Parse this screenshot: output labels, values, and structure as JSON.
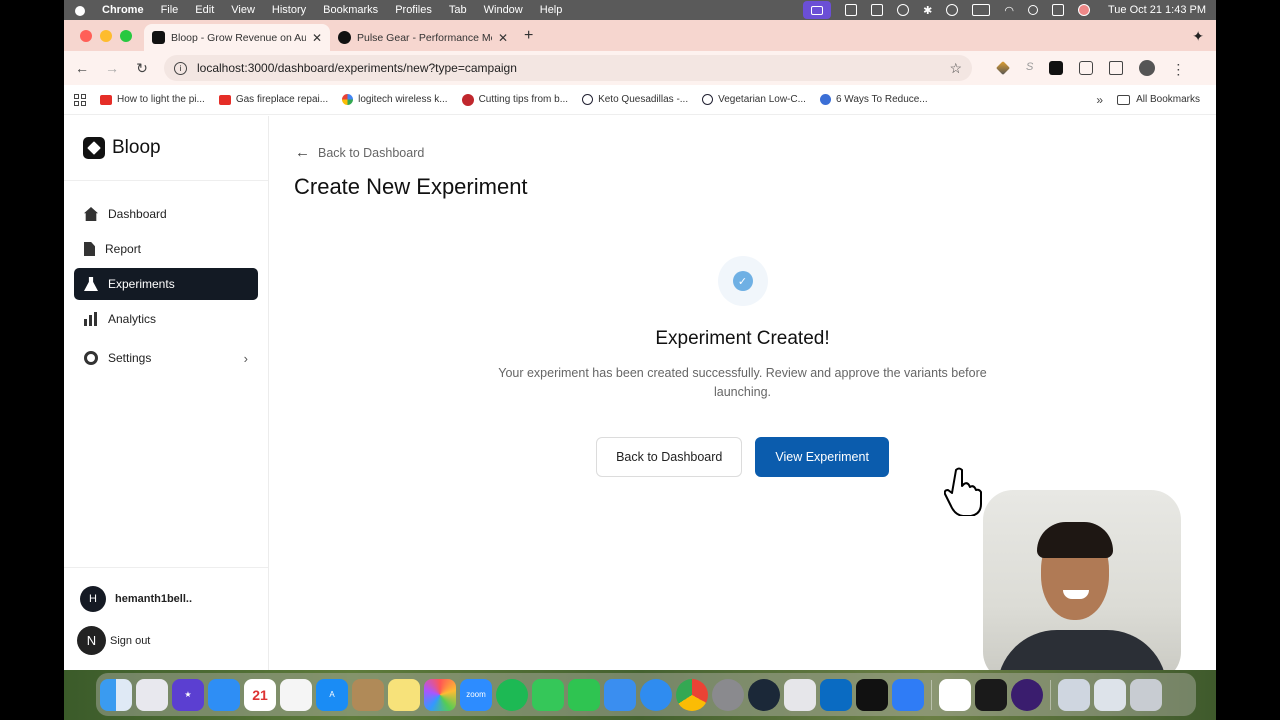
{
  "menubar": {
    "app_name": "Chrome",
    "items": [
      "File",
      "Edit",
      "View",
      "History",
      "Bookmarks",
      "Profiles",
      "Tab",
      "Window",
      "Help"
    ],
    "clock": "Tue Oct 21  1:43 PM"
  },
  "browser": {
    "tabs": [
      {
        "title": "Bloop - Grow Revenue on Aut",
        "active": true
      },
      {
        "title": "Pulse Gear - Performance Me",
        "active": false
      }
    ],
    "new_tab_label": "+",
    "url": "localhost:3000/dashboard/experiments/new?type=campaign",
    "bookmarks": [
      {
        "label": "How to light the pi...",
        "icon": "youtube-icon"
      },
      {
        "label": "Gas fireplace repai...",
        "icon": "youtube-icon"
      },
      {
        "label": "logitech wireless k...",
        "icon": "google-icon"
      },
      {
        "label": "Cutting tips from b...",
        "icon": "star-badge-icon"
      },
      {
        "label": "Keto Quesadillas -...",
        "icon": "d-logo-icon"
      },
      {
        "label": "Vegetarian Low-C...",
        "icon": "d-logo-icon"
      },
      {
        "label": "6 Ways To Reduce...",
        "icon": "blue-circle-icon"
      }
    ],
    "bookmarks_more": "»",
    "all_bookmarks": "All Bookmarks"
  },
  "sidebar": {
    "brand": "Bloop",
    "items": [
      {
        "label": "Dashboard",
        "icon": "home-icon",
        "active": false
      },
      {
        "label": "Report",
        "icon": "document-icon",
        "active": false
      },
      {
        "label": "Experiments",
        "icon": "flask-icon",
        "active": true
      },
      {
        "label": "Analytics",
        "icon": "bar-chart-icon",
        "active": false
      },
      {
        "label": "Settings",
        "icon": "gear-icon",
        "active": false,
        "chevron": "›"
      }
    ],
    "user": {
      "initial": "H",
      "name": "hemanth1bell.."
    },
    "signout": {
      "initial": "N",
      "label": "Sign out"
    }
  },
  "main": {
    "back_link": "Back to Dashboard",
    "title": "Create New Experiment",
    "success": {
      "check": "✓",
      "title": "Experiment Created!",
      "message": "Your experiment has been created successfully. Review and approve the variants before launching.",
      "secondary_button": "Back to Dashboard",
      "primary_button": "View Experiment"
    }
  },
  "dock": {
    "calendar_day": "21",
    "calendar_month": "OCT",
    "zoom_label": "zoom"
  },
  "colors": {
    "primary": "#0b5cad",
    "sidebar_active": "#131a24",
    "check": "#6fb0e4",
    "tabstrip": "#f6d6cf"
  }
}
